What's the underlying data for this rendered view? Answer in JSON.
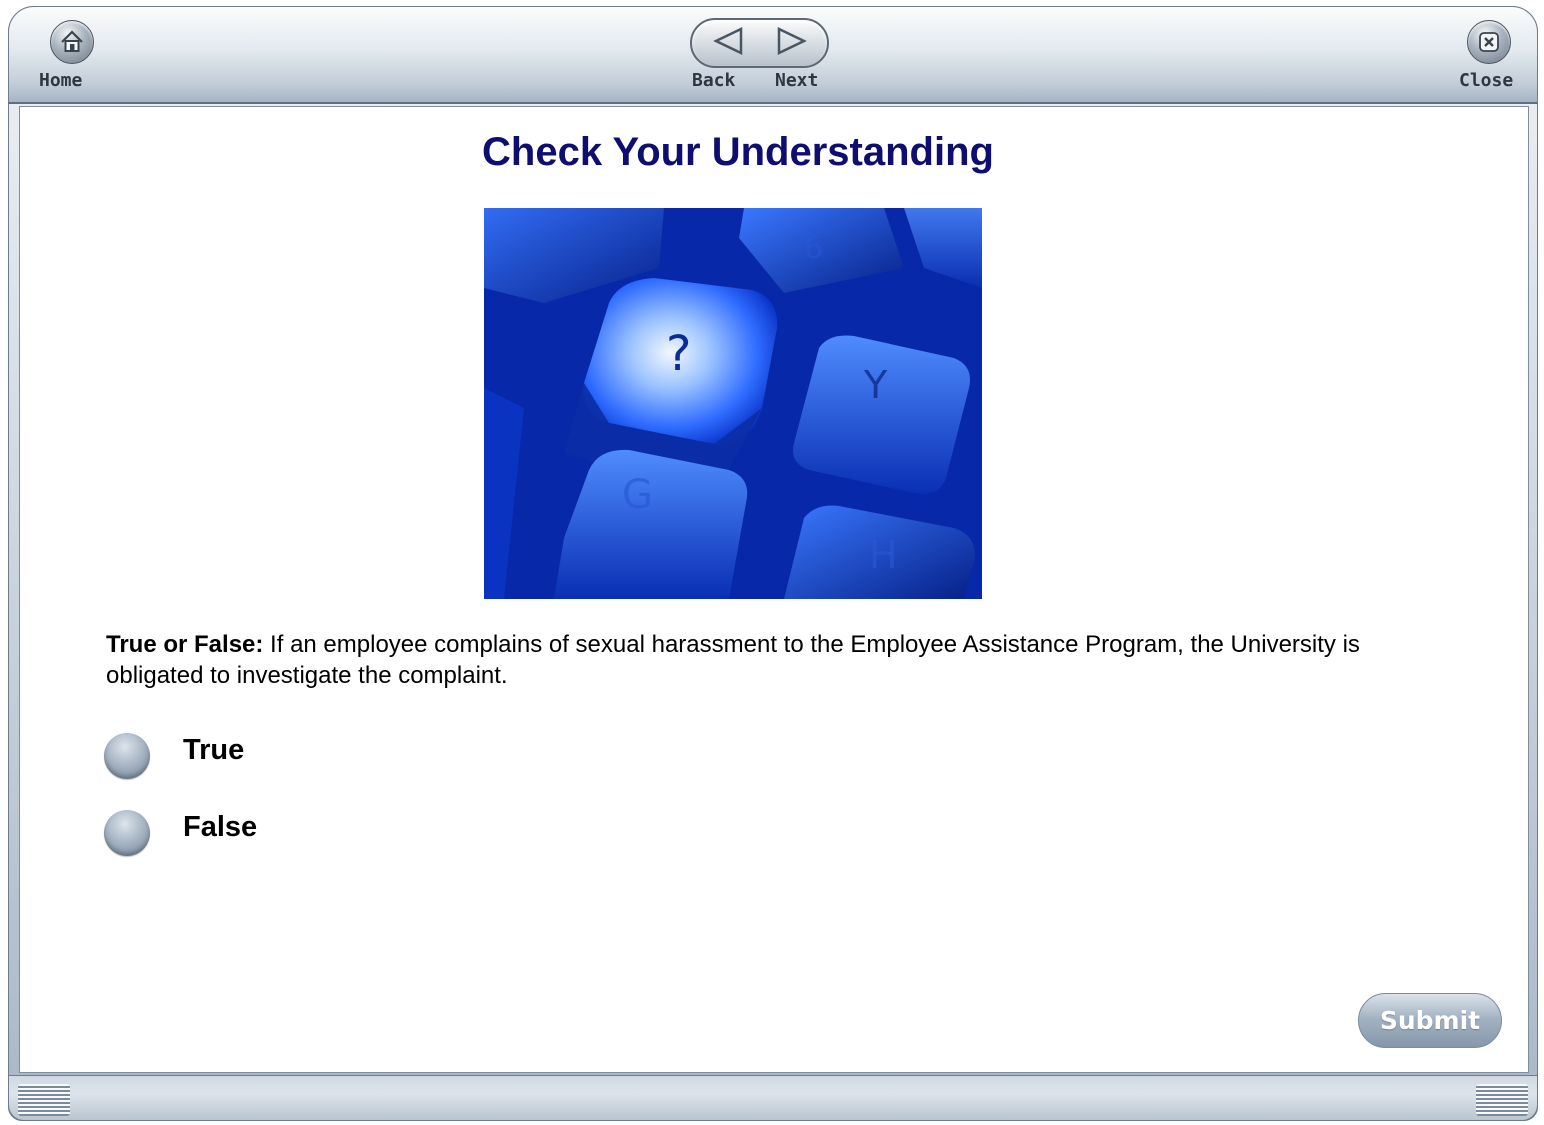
{
  "toolbar": {
    "home_label": "Home",
    "back_label": "Back",
    "next_label": "Next",
    "close_label": "Close"
  },
  "page": {
    "title": "Check Your Understanding",
    "image_keys": [
      "?",
      "Y",
      "G",
      "H",
      "6"
    ]
  },
  "question": {
    "prefix": "True or False:",
    "text": " If an employee complains of sexual harassment to the Employee Assistance Program, the University is obligated to investigate the complaint."
  },
  "options": [
    {
      "label": "True",
      "selected": false
    },
    {
      "label": "False",
      "selected": false
    }
  ],
  "submit_label": "Submit",
  "colors": {
    "title": "#0d0e6f",
    "accent_blue": "#0a3ee6",
    "chrome": "#a9b7c6"
  },
  "icons": {
    "home": "house-icon",
    "back": "triangle-left-icon",
    "next": "triangle-right-icon",
    "close": "x-icon"
  }
}
